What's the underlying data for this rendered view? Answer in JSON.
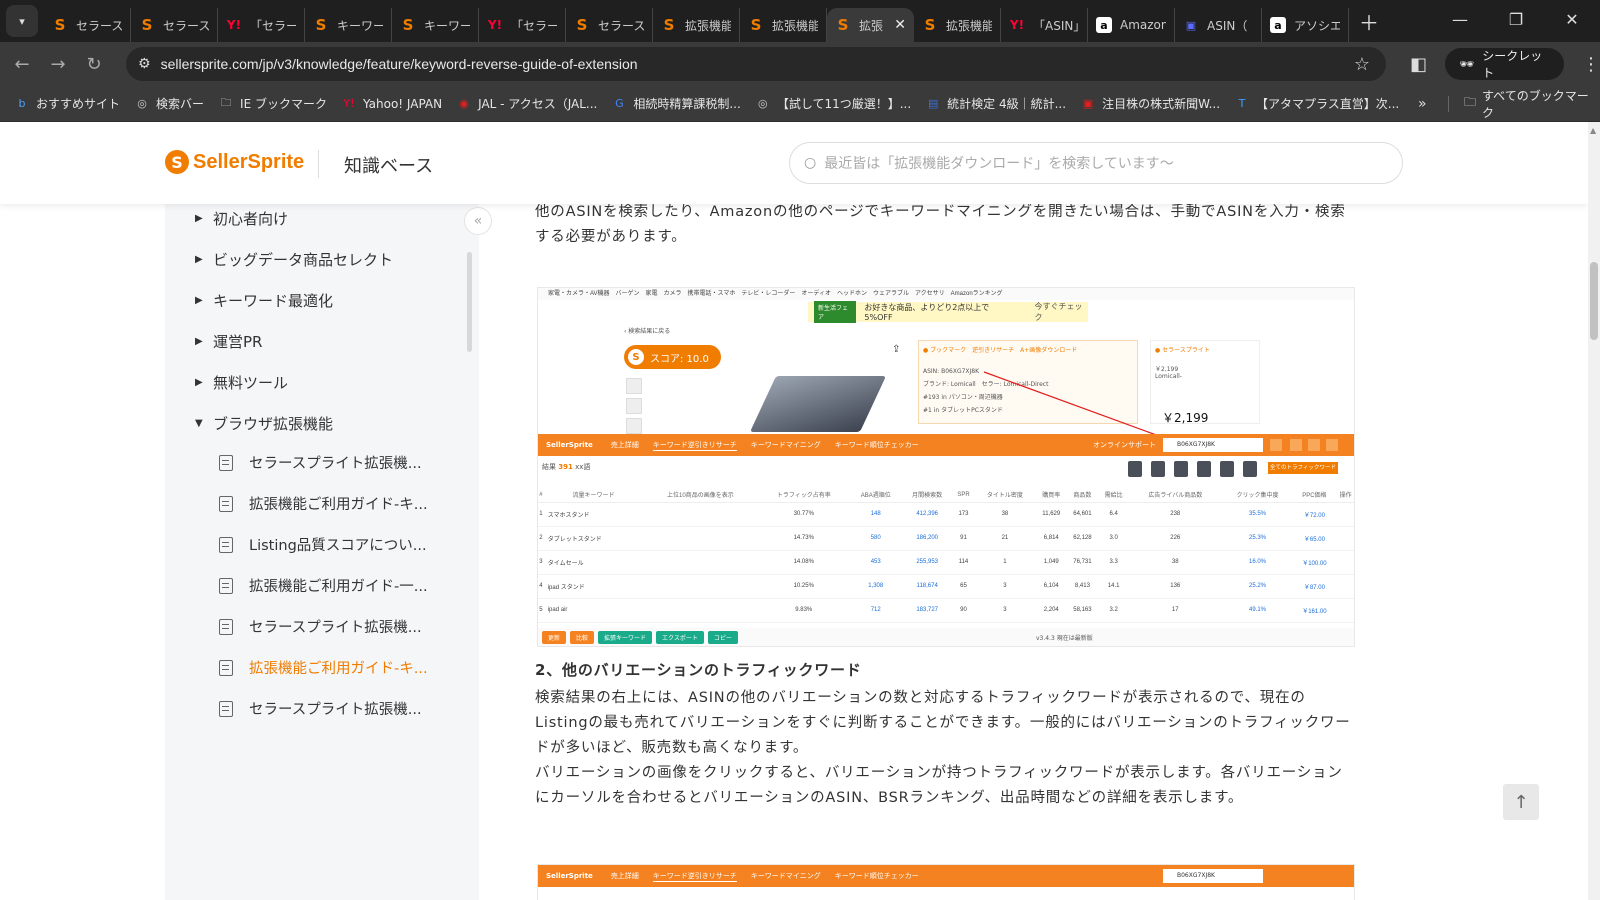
{
  "browser": {
    "tabs": [
      {
        "title": "セラースプライト",
        "favicon": "s",
        "active": false
      },
      {
        "title": "セラースプライト",
        "favicon": "s",
        "active": false
      },
      {
        "title": "「セラースプライト",
        "favicon": "y",
        "active": false
      },
      {
        "title": "キーワード",
        "favicon": "s",
        "active": false
      },
      {
        "title": "キーワード",
        "favicon": "s",
        "active": false
      },
      {
        "title": "「セラースプライト",
        "favicon": "y",
        "active": false
      },
      {
        "title": "セラースプライト",
        "favicon": "s",
        "active": false
      },
      {
        "title": "拡張機能",
        "favicon": "s",
        "active": false
      },
      {
        "title": "拡張機能",
        "favicon": "s",
        "active": false
      },
      {
        "title": "拡張",
        "favicon": "s",
        "active": true
      },
      {
        "title": "拡張機能",
        "favicon": "s",
        "active": false
      },
      {
        "title": "「ASIN」",
        "favicon": "y",
        "active": false
      },
      {
        "title": "Amazon",
        "favicon": "a",
        "active": false
      },
      {
        "title": "ASIN（",
        "favicon": "b",
        "active": false
      },
      {
        "title": "アソシエ",
        "favicon": "a",
        "active": false
      }
    ],
    "url": "sellersprite.com/jp/v3/knowledge/feature/keyword-reverse-guide-of-extension",
    "incognito_label": "シークレット",
    "bookmarks": [
      {
        "label": "おすすめサイト",
        "icon": "bing-icon"
      },
      {
        "label": "検索バー",
        "icon": "globe-icon"
      },
      {
        "label": "IE ブックマーク",
        "icon": "folder-icon"
      },
      {
        "label": "Yahoo! JAPAN",
        "icon": "yahoo-icon"
      },
      {
        "label": "JAL - アクセス（JAL...",
        "icon": "jal-icon"
      },
      {
        "label": "相続時精算課税制...",
        "icon": "google-icon"
      },
      {
        "label": "【試して11つ厳選！】...",
        "icon": "globe-icon"
      },
      {
        "label": "統計検定 4級｜統計...",
        "icon": "jsc-icon"
      },
      {
        "label": "注目株の株式新聞W...",
        "icon": "stock-icon"
      },
      {
        "label": "【アタマプラス直営】次...",
        "icon": "t-icon"
      }
    ],
    "all_bookmarks_label": "すべてのブックマーク"
  },
  "header": {
    "logo_text": "SellerSprite",
    "section_title": "知識ベース",
    "search_placeholder": "最近皆は「拡張機能ダウンロード」を検索しています〜"
  },
  "sidebar": {
    "categories": [
      {
        "label": "初心者向け",
        "expanded": false
      },
      {
        "label": "ビッグデータ商品セレクト",
        "expanded": false
      },
      {
        "label": "キーワード最適化",
        "expanded": false
      },
      {
        "label": "運営PR",
        "expanded": false
      },
      {
        "label": "無料ツール",
        "expanded": false
      },
      {
        "label": "ブラウザ拡張機能",
        "expanded": true
      }
    ],
    "docs": [
      {
        "label": "セラースプライト拡張機...",
        "active": false
      },
      {
        "label": "拡張機能ご利用ガイド-キ...",
        "active": false
      },
      {
        "label": "Listing品質スコアについ...",
        "active": false
      },
      {
        "label": "拡張機能ご利用ガイド-一...",
        "active": false
      },
      {
        "label": "セラースプライト拡張機...",
        "active": false
      },
      {
        "label": "拡張機能ご利用ガイド-キ...",
        "active": true
      },
      {
        "label": "セラースプライト拡張機...",
        "active": false
      }
    ]
  },
  "article": {
    "para1": "他のASINを検索したり、Amazonの他のページでキーワードマイニングを開きたい場合は、手動でASINを入力・検索する必要があります。",
    "heading2": "2、他のバリエーションのトラフィックワード",
    "para2": "検索結果の右上には、ASINの他のバリエーションの数と対応するトラフィックワードが表示されるので、現在のListingの最も売れてバリエーションをすぐに判断することができます。一般的にはバリエーションのトラフィックワードが多いほど、販売数も高くなります。",
    "para3": "バリエーションの画像をクリックすると、バリエーションが持つトラフィックワードが表示します。各バリエーションにカーソルを合わせるとバリエーションのASIN、BSRランキング、出品時間などの詳細を表示します。"
  },
  "screenshot1": {
    "amazon_nav": "家電・カメラ・AV機器　バーゲン　家電　カメラ　携帯電話・スマホ　テレビ・レコーダー　オーディオ　ヘッドホン　ウェアラブル　アクセサリ　Amazonランキング",
    "banner_tag": "新生活フェア",
    "banner_text": "お好きな商品、よりどり2点以上で5%OFF",
    "banner_link": "今すぐチェック",
    "back_link": "‹ 検索結果に戻る",
    "score_label": "スコア: 10.0",
    "info_asin": "ASIN: B06XG7XJ8K",
    "info_brand": "ブランド: Lomicall　セラー: Lomicall-Direct",
    "info_rank1": "#193 in パソコン・周辺機器",
    "info_rank2": "#1 in タブレットPCスタンド",
    "side_price_small": "￥2,199",
    "side_seller": "Lomicall-",
    "price": "￥2,199",
    "ext_brand": "SellerSprite",
    "ext_tabs": [
      "売上詳細",
      "キーワード逆引きリサーチ",
      "キーワードマイニング",
      "キーワード順位チェッカー"
    ],
    "ext_online_support": "オンラインサポート",
    "ext_asin_value": "B06XG7XJ8K",
    "results_prefix": "結果",
    "results_count": "391",
    "results_suffix": "xx語",
    "all_traffic_btn": "全てのトラフィックワード",
    "columns": [
      "#",
      "流量キーワード",
      "上位10商品の画像を表示",
      "トラフィック占有率",
      "ABA週順位",
      "月間検索数",
      "SPR",
      "タイトル密度",
      "購買率",
      "商品数",
      "需給比",
      "広告ライバル商品数",
      "クリック集中度",
      "PPC価格",
      "操作"
    ],
    "rows": [
      {
        "n": "1",
        "kw": "スマホスタンド",
        "share": "30.77%",
        "aba": "148",
        "vol": "412,396",
        "spr": "173",
        "title": "38",
        "buy": "11,629",
        "products": "64,601",
        "ratio": "6.4",
        "ads": "238",
        "click": "35.5%",
        "ppc": "￥72.00"
      },
      {
        "n": "2",
        "kw": "タブレットスタンド",
        "share": "14.73%",
        "aba": "580",
        "vol": "186,200",
        "spr": "91",
        "title": "21",
        "buy": "6,814",
        "products": "62,128",
        "ratio": "3.0",
        "ads": "226",
        "click": "25.3%",
        "ppc": "￥65.00"
      },
      {
        "n": "3",
        "kw": "タイムセール",
        "share": "14.08%",
        "aba": "453",
        "vol": "255,953",
        "spr": "114",
        "title": "1",
        "buy": "1,049",
        "products": "76,731",
        "ratio": "3.3",
        "ads": "38",
        "click": "16.0%",
        "ppc": "￥100.00"
      },
      {
        "n": "4",
        "kw": "ipad スタンド",
        "share": "10.25%",
        "aba": "1,308",
        "vol": "118,674",
        "spr": "65",
        "title": "3",
        "buy": "6,104",
        "products": "8,413",
        "ratio": "14.1",
        "ads": "136",
        "click": "25.2%",
        "ppc": "￥87.00"
      },
      {
        "n": "5",
        "kw": "ipad air",
        "share": "9.83%",
        "aba": "712",
        "vol": "183,727",
        "spr": "90",
        "title": "3",
        "buy": "2,204",
        "products": "58,163",
        "ratio": "3.2",
        "ads": "17",
        "click": "49.1%",
        "ppc": "￥161.00"
      }
    ],
    "bottom_buttons": [
      {
        "label": "更新",
        "color": "#f58220"
      },
      {
        "label": "比較",
        "color": "#f58220"
      },
      {
        "label": "拡張キーワード",
        "color": "#1aab8a"
      },
      {
        "label": "エクスポート",
        "color": "#1aab8a"
      },
      {
        "label": "コピー",
        "color": "#1aab8a"
      }
    ],
    "bottom_version": "v3.4.3 現在は最新版"
  },
  "screenshot2": {
    "ext_brand": "SellerSprite",
    "ext_tabs": [
      "売上詳細",
      "キーワード逆引きリサーチ",
      "キーワードマイニング",
      "キーワード順位チェッカー"
    ],
    "ext_asin_value": "B06XG7XJ8K"
  },
  "colors": {
    "brand": "#f07c00",
    "ext_bar": "#f58220",
    "active_doc": "#f07c00"
  }
}
